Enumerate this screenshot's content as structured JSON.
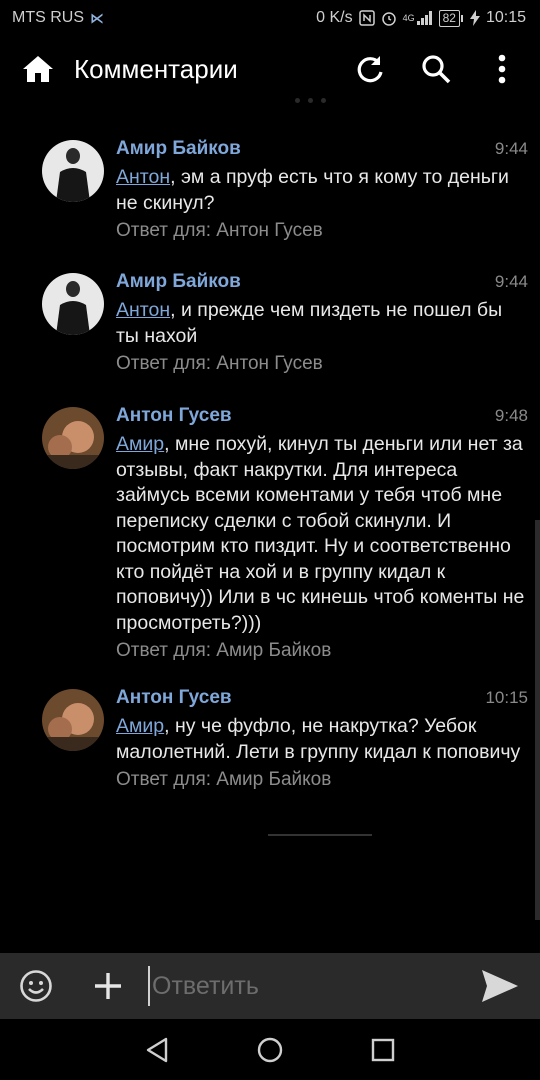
{
  "status_bar": {
    "carrier": "MTS RUS",
    "net_speed": "0 K/s",
    "network": "4G",
    "battery": "82",
    "time": "10:15"
  },
  "toolbar": {
    "title": "Комментарии",
    "icons": [
      "home-icon",
      "refresh-icon",
      "search-icon",
      "more-vert-icon"
    ]
  },
  "comments": [
    {
      "author": "Амир Байков",
      "time": "9:44",
      "mention": "Антон",
      "text": ", эм а пруф  есть что я кому то деньги не скинул?",
      "reply": "Ответ для: Антон Гусев"
    },
    {
      "author": "Амир Байков",
      "time": "9:44",
      "mention": "Антон",
      "text": ", и прежде чем пиздеть не пошел бы ты нахой",
      "reply": "Ответ для: Антон Гусев"
    },
    {
      "author": "Антон Гусев",
      "time": "9:48",
      "mention": "Амир",
      "text": ", мне похуй, кинул ты деньги или нет за отзывы, факт накрутки. Для интереса займусь всеми коментами у тебя чтоб мне переписку сделки с тобой скинули. И посмотрим кто пиздит. Ну и соответственно кто пойдёт на хой и в группу кидал к поповичу)) Или в чс кинешь чтоб коменты не просмотреть?)))",
      "reply": "Ответ для: Амир Байков"
    },
    {
      "author": "Антон Гусев",
      "time": "10:15",
      "mention": "Амир",
      "text": ", ну че фуфло, не накрутка? Уебок малолетний. Лети в группу кидал к поповичу",
      "reply": "Ответ для: Амир Байков"
    }
  ],
  "input": {
    "placeholder": "Ответить",
    "value": ""
  },
  "colors": {
    "accent": "#7fa7d9",
    "background": "#000000",
    "input_bar": "#2a2a2a"
  }
}
